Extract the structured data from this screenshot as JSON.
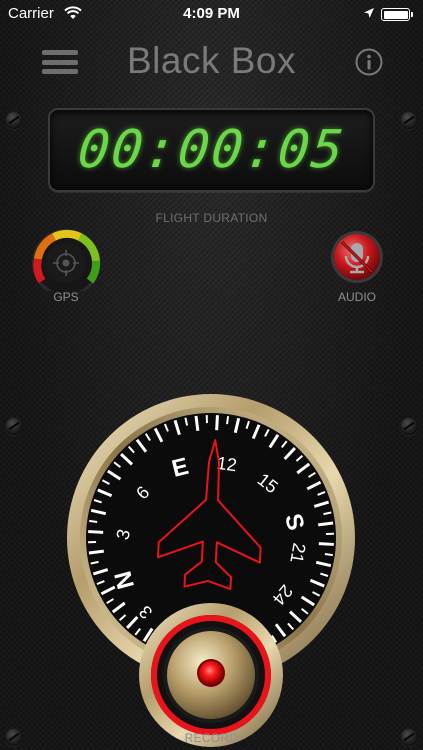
{
  "status_bar": {
    "carrier": "Carrier",
    "time": "4:09 PM"
  },
  "nav": {
    "title": "Black Box",
    "menu_icon": "hamburger-menu-icon",
    "info_icon": "info-icon"
  },
  "timer": {
    "value": "00:00:05",
    "label": "FLIGHT DURATION",
    "color": "#6bd84a"
  },
  "indicators": {
    "gps": {
      "label": "GPS",
      "icon": "gps-gauge-icon"
    },
    "audio": {
      "label": "AUDIO",
      "icon": "microphone-muted-icon"
    }
  },
  "compass": {
    "cardinals": [
      "E",
      "S",
      "N"
    ],
    "degree_marks": [
      "12",
      "15",
      "21",
      "24",
      "3",
      "6",
      "3"
    ]
  },
  "record": {
    "label": "RECORD",
    "icon": "record-button-icon"
  },
  "colors": {
    "accent_green": "#6bd84a",
    "record_red": "#e8141a",
    "bezel_gold": "#c9b48a"
  }
}
